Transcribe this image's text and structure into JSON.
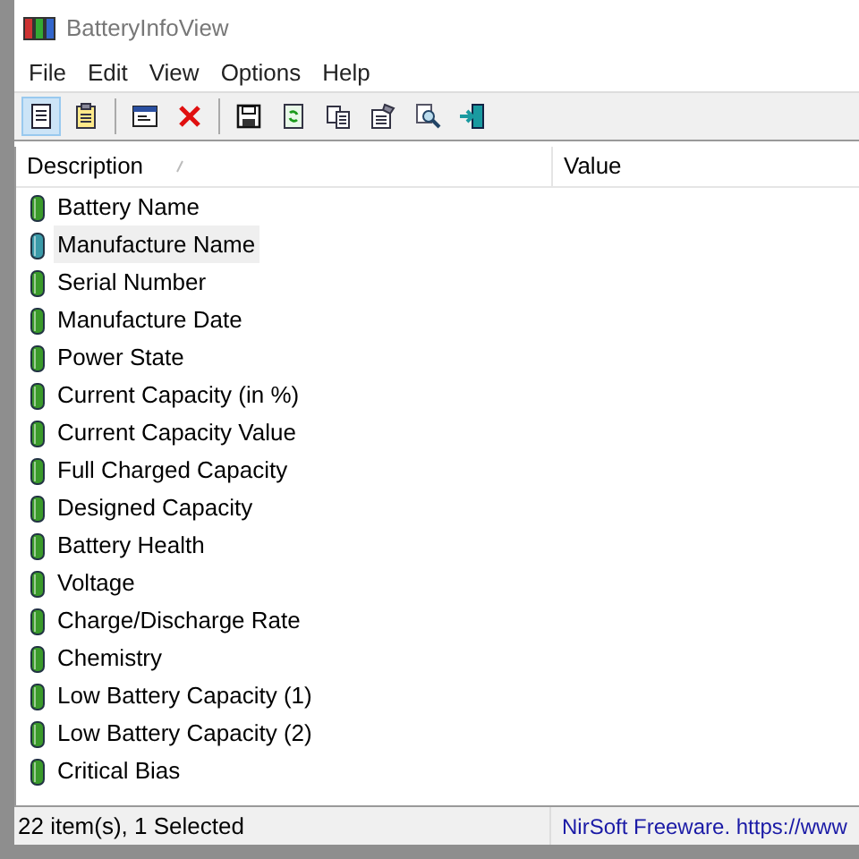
{
  "window": {
    "title": "BatteryInfoView"
  },
  "menu": [
    "File",
    "Edit",
    "View",
    "Options",
    "Help"
  ],
  "toolbar": [
    {
      "kind": "button",
      "pressed": true
    },
    {
      "kind": "button",
      "pressed": false
    },
    {
      "kind": "separator"
    },
    {
      "kind": "button",
      "pressed": false
    },
    {
      "kind": "button",
      "pressed": false
    },
    {
      "kind": "separator"
    },
    {
      "kind": "button",
      "pressed": false
    },
    {
      "kind": "button",
      "pressed": false
    },
    {
      "kind": "button",
      "pressed": false
    },
    {
      "kind": "button",
      "pressed": false
    },
    {
      "kind": "button",
      "pressed": false
    },
    {
      "kind": "button",
      "pressed": false
    }
  ],
  "table": {
    "columns": [
      "Description",
      "Value"
    ],
    "rows": [
      {
        "description": "Battery Name",
        "selected": false
      },
      {
        "description": "Manufacture Name",
        "selected": true
      },
      {
        "description": "Serial Number",
        "selected": false
      },
      {
        "description": "Manufacture Date",
        "selected": false
      },
      {
        "description": "Power State",
        "selected": false
      },
      {
        "description": "Current Capacity (in %)",
        "selected": false
      },
      {
        "description": "Current Capacity Value",
        "selected": false
      },
      {
        "description": "Full Charged Capacity",
        "selected": false
      },
      {
        "description": "Designed Capacity",
        "selected": false
      },
      {
        "description": "Battery Health",
        "selected": false
      },
      {
        "description": "Voltage",
        "selected": false
      },
      {
        "description": "Charge/Discharge Rate",
        "selected": false
      },
      {
        "description": "Chemistry",
        "selected": false
      },
      {
        "description": "Low Battery Capacity (1)",
        "selected": false
      },
      {
        "description": "Low Battery Capacity (2)",
        "selected": false
      },
      {
        "description": "Critical Bias",
        "selected": false
      }
    ]
  },
  "status_bar": {
    "count": "22 item(s), 1 Selected",
    "link": "NirSoft Freeware. https://www"
  }
}
